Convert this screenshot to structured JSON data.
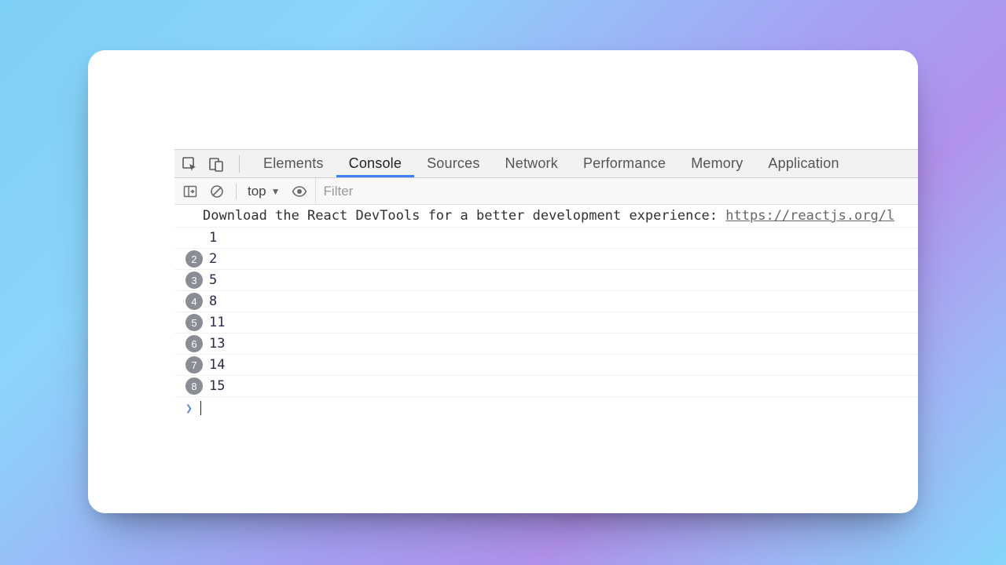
{
  "tabs": {
    "elements": "Elements",
    "console": "Console",
    "sources": "Sources",
    "network": "Network",
    "performance": "Performance",
    "memory": "Memory",
    "application": "Application"
  },
  "active_tab": "console",
  "controlbar": {
    "context": "top",
    "filter_placeholder": "Filter"
  },
  "info_message": {
    "text": "Download the React DevTools for a better development experience: ",
    "link": "https://reactjs.org/l"
  },
  "log_rows": [
    {
      "count": null,
      "value": "1"
    },
    {
      "count": "2",
      "value": "2"
    },
    {
      "count": "3",
      "value": "5"
    },
    {
      "count": "4",
      "value": "8"
    },
    {
      "count": "5",
      "value": "11"
    },
    {
      "count": "6",
      "value": "13"
    },
    {
      "count": "7",
      "value": "14"
    },
    {
      "count": "8",
      "value": "15"
    }
  ]
}
